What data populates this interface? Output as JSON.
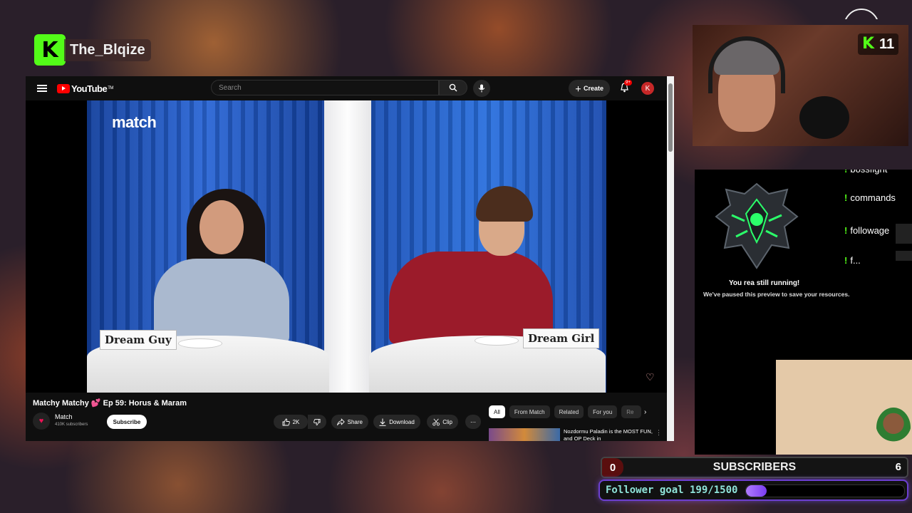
{
  "streamer": {
    "logo_letter": "K",
    "name": "The_Blqize",
    "brand_color": "#53fc18"
  },
  "youtube": {
    "logo_text": "YouTube",
    "logo_tm": "TM",
    "search_placeholder": "Search",
    "create_label": "Create",
    "notifications_badge": "9+",
    "account_initial": "K",
    "video": {
      "brand_logo": "match",
      "card_left": "Dream Guy",
      "card_right": "Dream Girl"
    },
    "title": "Matchy Matchy 💕 Ep 59: Horus & Maram",
    "channel": {
      "name": "Match",
      "subscribers": "410K subscribers"
    },
    "subscribe_label": "Subscribe",
    "actions": {
      "likes": "2K",
      "share": "Share",
      "download": "Download",
      "clip": "Clip",
      "more": "⋯"
    },
    "chips": [
      "All",
      "From Match",
      "Related",
      "For you",
      "Re"
    ],
    "recommendation": {
      "title": "Nozdormu Paladin is the MOST FUN, and OP Deck in"
    }
  },
  "webcam": {
    "kick_count": "11"
  },
  "bot_panel": {
    "commands": [
      "bossfight",
      "commands",
      "followage",
      "f..."
    ],
    "message_line1": "You   rea   still running!",
    "message_line2": "We've paused this preview to save your resources."
  },
  "subscribers": {
    "left": "0",
    "label": "SUBSCRIBERS",
    "right": "6"
  },
  "follower_goal": {
    "label": "Follower goal 199/1500",
    "current": 199,
    "target": 1500
  }
}
